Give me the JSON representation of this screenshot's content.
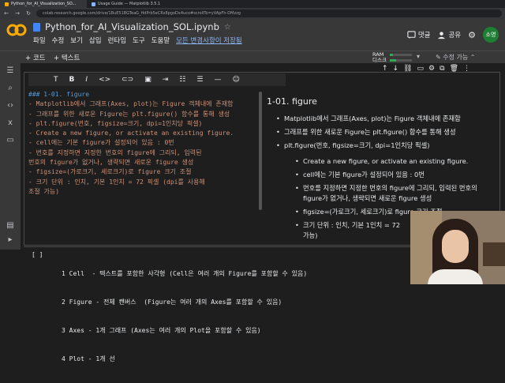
{
  "browser": {
    "tabs": [
      {
        "label": "Python_for_AI_Visualization_SO...",
        "active": true
      },
      {
        "label": "Usage Guide — Matplotlib 3.5.1",
        "active": false
      }
    ],
    "url": "colab.research.google.com/drive/1BuE51BGTeaG_HdPrb5eCRs8pgoDx4uco#scrollTo=yVApFh-DMzzg"
  },
  "header": {
    "logo_text": "CO",
    "notebook_title": "Python_for_AI_Visualization_SOL.ipynb",
    "menu": [
      "파일",
      "수정",
      "보기",
      "삽입",
      "런타임",
      "도구",
      "도움말"
    ],
    "saved_status": "모든 변경사항이 저장됨",
    "comment_label": "댓글",
    "share_label": "공유",
    "avatar_text": "소영"
  },
  "toolbar": {
    "add_code": "+ 코드",
    "add_text": "+ 텍스트",
    "ram_label": "RAM",
    "disk_label": "디스크",
    "ram_fill": 0.15,
    "disk_fill": 0.3,
    "edit_mode": "수정 가능"
  },
  "md_toolbar": [
    "T",
    "B",
    "I",
    "<>",
    "link",
    "img",
    "indent",
    "ol",
    "ul",
    "hr",
    "emoji"
  ],
  "cell_tools": [
    "↑",
    "↓",
    "link",
    "comment",
    "settings",
    "mirror",
    "delete",
    "more"
  ],
  "editor": {
    "lines": [
      "### 1-01. figure",
      "- Matplotlib에서 그래프(Axes, plot)는 Figure 객체내에 존재함",
      "- 그래프를 위한 새로운 Figure는 plt.figure() 함수를 통해 생성",
      "- plt.figure(번호, figsize=크기, dpi=1인치당 픽셀)",
      "    - Create a new figure, or activate an existing figure.",
      "    - cell에는 기본 figure가 설정되어 있음 : 0번",
      "    - 번호를 지정하면 지정한 번호의 figure에 그리되, 입력된",
      "번호의 figure가 없거나, 생략되면 새로운 figure 생성",
      "    - figsize=(가로크기, 세로크기)로 figure 크기 조절",
      "    - 크기 단위 : 인치, 기본 1인치 = 72 픽셀 (dpi를 사용해",
      "조절 가능)"
    ]
  },
  "preview": {
    "heading": "1-01. figure",
    "bullets": [
      "Matplotlib에서 그래프(Axes, plot)는 Figure 객체내에 존재함",
      "그래프를 위한 새로운 Figure는 plt.figure() 함수를 통해 생성",
      "plt.figure(번호, figsize=크기, dpi=1인치당 픽셀)"
    ],
    "sub_bullets": [
      "Create a new figure, or activate an existing figure.",
      "cell에는 기본 figure가 설정되어 있음 : 0번",
      "번호를 지정하면 지정한 번호의 figure에 그리되, 입력된 번호의 figure가 없거나, 생략되면 새로운 figure 생성",
      "figsize=(가로크기, 세로크기)로 figure 크기 조절",
      "크기 단위 : 인치, 기본 1인치 = 72",
      "가능)"
    ]
  },
  "output": {
    "bracket": "[ ]",
    "lines": [
      "1 Cell  - 텍스트를 포함한 사각형 (Cell은 여러 개의 Figure를 포함할 수 있음)",
      "2 Figure - 전체 캔버스  (Figure는 여러 개의 Axes를 포함할 수 있음)",
      "3 Axes - 1개 그래프 (Axes는 여러 개의 Plot을 포함할 수 있음)",
      "4 Plot - 1개 선"
    ]
  }
}
